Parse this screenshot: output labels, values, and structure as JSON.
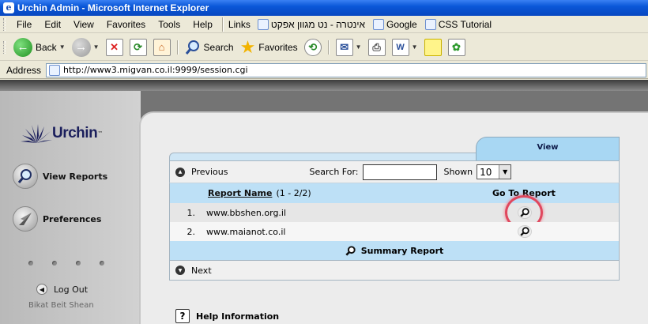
{
  "window": {
    "title": "Urchin Admin - Microsoft Internet Explorer"
  },
  "menu": {
    "items": [
      "File",
      "Edit",
      "View",
      "Favorites",
      "Tools",
      "Help"
    ],
    "links_label": "Links",
    "links": [
      "אינטרה - נט מגוון אפקט",
      "Google",
      "CSS Tutorial"
    ]
  },
  "toolbar": {
    "back_label": "Back",
    "search_label": "Search",
    "favorites_label": "Favorites"
  },
  "address": {
    "label": "Address",
    "url": "http://www3.migvan.co.il:9999/session.cgi"
  },
  "sidebar": {
    "logo_text": "Urchin",
    "logo_tm": "™",
    "nav": [
      "View Reports",
      "Preferences"
    ],
    "logout": "Log Out",
    "organization": "Bikat Beit Shean"
  },
  "panel": {
    "tab_label": "View",
    "previous_label": "Previous",
    "search_label": "Search For:",
    "search_value": "",
    "shown_label": "Shown",
    "shown_value": "10",
    "column_report_name": "Report Name",
    "range_text": "(1 - 2/2)",
    "column_goto": "Go To Report",
    "rows": [
      {
        "index": "1.",
        "domain": "www.bbshen.org.il"
      },
      {
        "index": "2.",
        "domain": "www.maianot.co.il"
      }
    ],
    "summary_label": "Summary Report",
    "next_label": "Next"
  },
  "help": {
    "label": "Help Information"
  },
  "colors": {
    "tab_blue": "#a8d7f3",
    "row_blue": "#bde0f6",
    "highlight_ring": "#e0485e",
    "logo_navy": "#1b1f5c"
  }
}
